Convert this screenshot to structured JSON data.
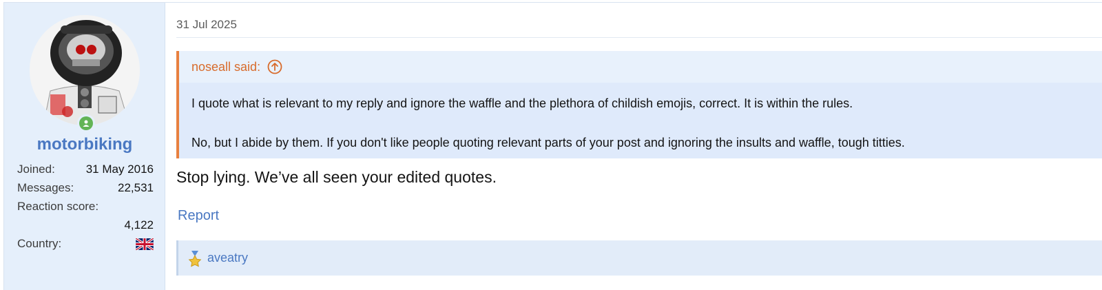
{
  "user": {
    "username": "motorbiking",
    "joined_label": "Joined:",
    "joined_value": "31 May 2016",
    "messages_label": "Messages:",
    "messages_value": "22,531",
    "reaction_label": "Reaction score:",
    "reaction_value": "4,122",
    "country_label": "Country:",
    "country_flag": "uk-flag-icon",
    "online": true
  },
  "post": {
    "date": "31 Jul 2025",
    "quote": {
      "author_line": "noseall said:",
      "lines": [
        "I quote what is relevant to my reply and ignore the waffle and the plethora of childish emojis, correct. It is within the rules.",
        "No, but I abide by them. If you don't like people quoting relevant parts of your post and ignoring the insults and waffle, tough titties."
      ]
    },
    "body": "Stop lying. We’ve all seen your edited quotes.",
    "report_label": "Report",
    "reactions": {
      "icon": "trophy-icon",
      "users": "aveatry"
    }
  },
  "colors": {
    "accent_link": "#4a78c2",
    "quote_border": "#e8803f",
    "quote_author": "#d86b2b",
    "online": "#63b456"
  }
}
